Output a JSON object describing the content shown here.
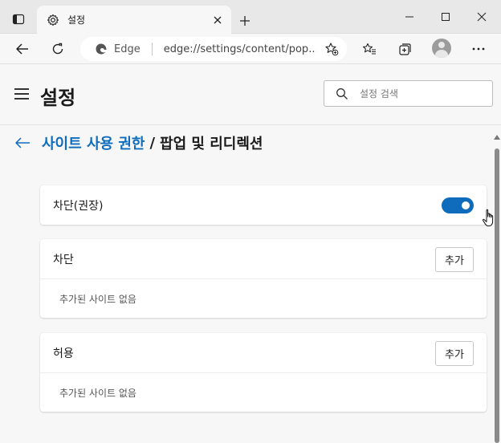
{
  "browser": {
    "tab_title": "설정",
    "site_name": "Edge",
    "url": "edge://settings/content/pop..."
  },
  "header": {
    "title": "설정",
    "search_placeholder": "설정 검색"
  },
  "breadcrumb": {
    "parent": "사이트 사용 권한",
    "separator": "/",
    "current": "팝업 및 리디렉션"
  },
  "blocked_toggle": {
    "label": "차단(권장)",
    "state": "on"
  },
  "block_section": {
    "title": "차단",
    "add_label": "추가",
    "empty_text": "추가된 사이트 없음"
  },
  "allow_section": {
    "title": "허용",
    "add_label": "추가",
    "empty_text": "추가된 사이트 없음"
  },
  "colors": {
    "accent": "#0f6cbd",
    "toggle_on": "#0f6cbd"
  }
}
